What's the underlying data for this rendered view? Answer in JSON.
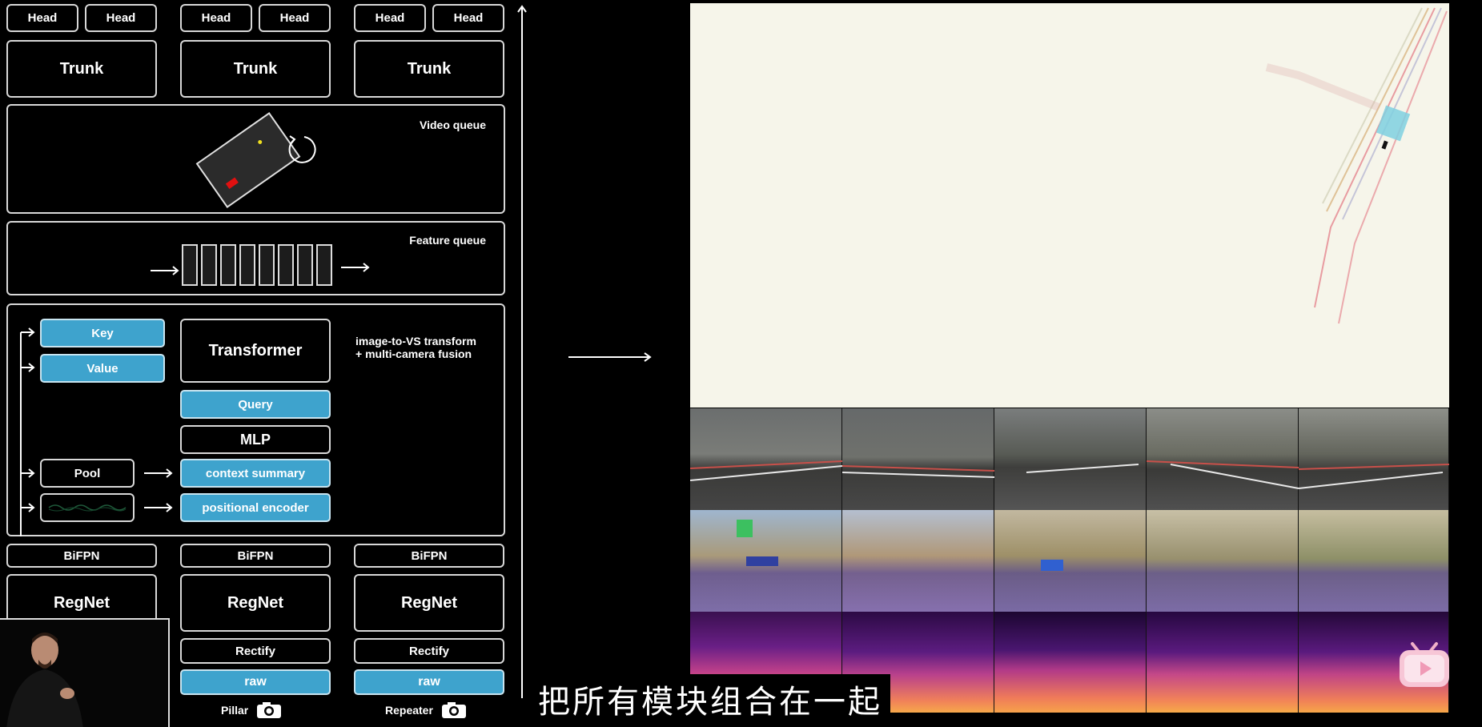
{
  "diagram": {
    "heads": [
      "Head",
      "Head",
      "Head",
      "Head",
      "Head",
      "Head"
    ],
    "trunks": [
      "Trunk",
      "Trunk",
      "Trunk"
    ],
    "video_queue_label": "Video queue",
    "feature_queue_label": "Feature queue",
    "fusion": {
      "key": "Key",
      "value": "Value",
      "transformer": "Transformer",
      "annotation_line1": "image-to-VS transform",
      "annotation_line2": "+ multi-camera fusion",
      "query": "Query",
      "mlp": "MLP",
      "pool": "Pool",
      "context_summary": "context summary",
      "positional_encoder": "positional encoder"
    },
    "bifpn": [
      "BiFPN",
      "BiFPN",
      "BiFPN"
    ],
    "regnet": [
      "RegNet",
      "RegNet",
      "RegNet"
    ],
    "rectify": [
      "Rectify",
      "Rectify"
    ],
    "raw": [
      "raw",
      "raw"
    ],
    "cameras": [
      "Pillar",
      "Repeater"
    ]
  },
  "video": {
    "subtitle": "把所有模块组合在一起"
  },
  "colors": {
    "accent_blue": "#3ea3cd",
    "vector_space_bg": "#f6f5ea"
  },
  "icons": [
    "camera-icon",
    "rotate-icon",
    "arrow-right-icon",
    "arrow-up-icon",
    "bilibili-play-icon"
  ]
}
